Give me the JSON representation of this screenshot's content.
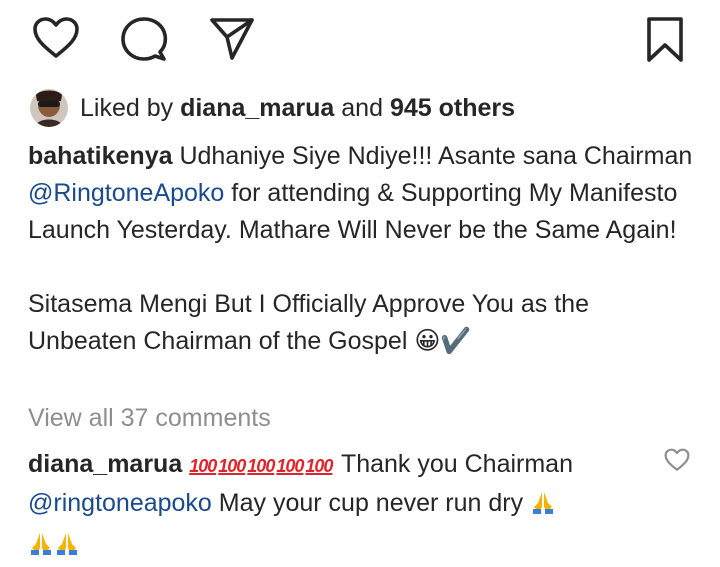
{
  "actions": {
    "like_icon": "heart-outline",
    "comment_icon": "speech-bubble",
    "share_icon": "paper-plane",
    "save_icon": "bookmark-outline"
  },
  "likes": {
    "prefix": "Liked by",
    "user": "diana_marua",
    "middle": "and",
    "others": "945 others"
  },
  "caption": {
    "username": "bahatikenya",
    "text1": "Udhaniye Siye Ndiye!!! Asante sana Chairman",
    "mention": "@RingtoneApoko",
    "text2": "for attending & Supporting My Manifesto Launch Yesterday. Mathare Will Never be the Same Again!",
    "text3": "Sitasema Mengi But I Officially Approve You as the Unbeaten Chairman of the Gospel",
    "text3_emoji": "😀✔️"
  },
  "view_comments": "View all 37 comments",
  "comment": {
    "username": "diana_marua",
    "hundreds": [
      "100",
      "100",
      "100",
      "100",
      "100"
    ],
    "text1": "Thank you Chairman",
    "mention": "@ringtoneapoko",
    "text2": "May your cup never run dry",
    "emoji_count": 3
  },
  "colors": {
    "text": "#262626",
    "mention": "#1a4b8c",
    "muted": "#8e8e8e",
    "hundred_red": "#e0242b"
  }
}
